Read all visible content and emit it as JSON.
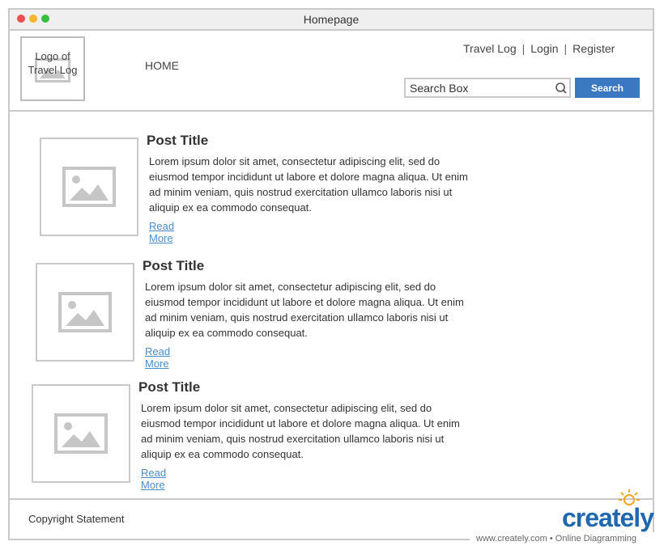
{
  "window": {
    "title": "Homepage"
  },
  "header": {
    "logo_text": "Logo of Travel Log",
    "nav_home": "HOME",
    "links": [
      "Travel Log",
      "Login",
      "Register"
    ],
    "link_separator": "|",
    "search": {
      "placeholder": "Search Box",
      "button_label": "Search"
    }
  },
  "posts": [
    {
      "title": "Post Title",
      "body": "Lorem ipsum dolor sit amet, consectetur adipiscing elit, sed do eiusmod tempor incididunt ut labore et dolore magna aliqua. Ut enim ad minim veniam, quis nostrud exercitation ullamco laboris nisi ut aliquip ex ea commodo consequat.",
      "read_more": "Read More"
    },
    {
      "title": "Post Title",
      "body": "Lorem ipsum dolor sit amet, consectetur adipiscing elit, sed do eiusmod tempor incididunt ut labore et dolore magna aliqua. Ut enim ad minim veniam, quis nostrud exercitation ullamco laboris nisi ut aliquip ex ea commodo consequat.",
      "read_more": "Read More"
    },
    {
      "title": "Post Title",
      "body": "Lorem ipsum dolor sit amet, consectetur adipiscing elit, sed do eiusmod tempor incididunt ut labore et dolore magna aliqua. Ut enim ad minim veniam, quis nostrud exercitation ullamco laboris nisi ut aliquip ex ea commodo consequat.",
      "read_more": "Read More"
    }
  ],
  "footer": {
    "copyright": "Copyright Statement"
  },
  "branding": {
    "name": "creately",
    "url": "www.creately.com • Online Diagramming"
  },
  "colors": {
    "accent": "#3b78c2",
    "link": "#4a8dcc",
    "border": "#c9c9c9",
    "brand": "#1f67b1",
    "brand_bulb": "#f5a623"
  }
}
